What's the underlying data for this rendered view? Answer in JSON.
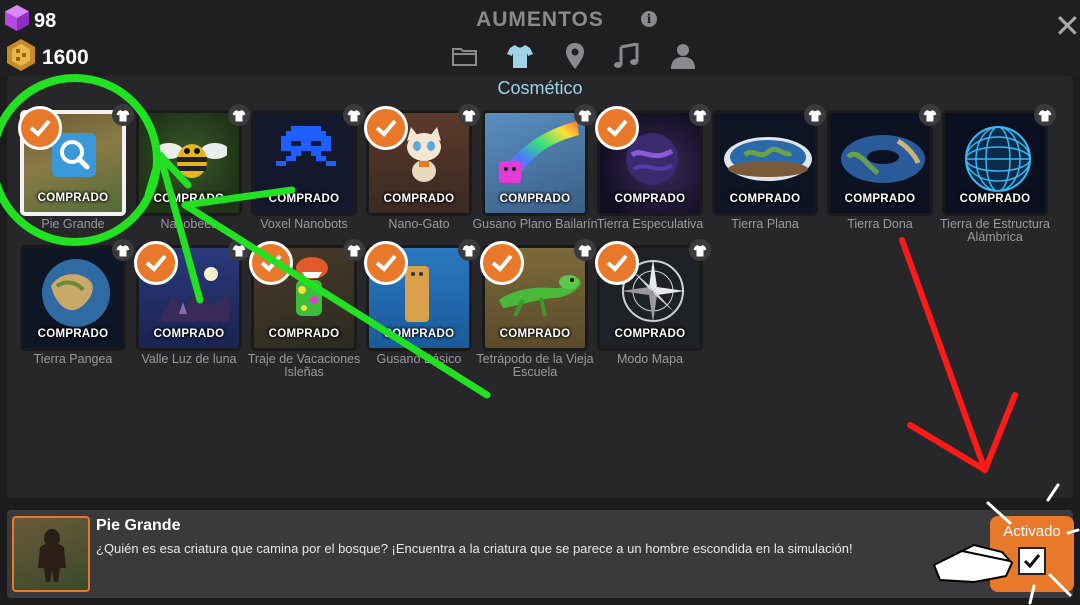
{
  "header": {
    "gems": "98",
    "coins": "1600",
    "title": "AUMENTOS"
  },
  "section": {
    "title": "Cosmético"
  },
  "tiles": [
    {
      "name": "Pie Grande",
      "badge": "COMPRADO"
    },
    {
      "name": "Nanobees",
      "badge": "COMPRADO"
    },
    {
      "name": "Voxel Nanobots",
      "badge": "COMPRADO"
    },
    {
      "name": "Nano-Gato",
      "badge": "COMPRADO"
    },
    {
      "name": "Gusano Plano Bailarín",
      "badge": "COMPRADO"
    },
    {
      "name": "Tierra Especulativa",
      "badge": "COMPRADO"
    },
    {
      "name": "Tierra Plana",
      "badge": "COMPRADO"
    },
    {
      "name": "Tierra Dona",
      "badge": "COMPRADO"
    },
    {
      "name": "Tierra de Estructura Alámbrica",
      "badge": "COMPRADO"
    },
    {
      "name": "Tierra Pangea",
      "badge": "COMPRADO"
    },
    {
      "name": "Valle Luz de luna",
      "badge": "COMPRADO"
    },
    {
      "name": "Traje de Vacaciones Isleñas",
      "badge": "COMPRADO"
    },
    {
      "name": "Gusano Básico",
      "badge": "COMPRADO"
    },
    {
      "name": "Tetrápodo de la Vieja Escuela",
      "badge": "COMPRADO"
    },
    {
      "name": "Modo Mapa",
      "badge": "COMPRADO"
    }
  ],
  "detail": {
    "name": "Pie Grande",
    "description": "¿Quién es esa criatura que camina por el bosque? ¡Encuentra a la criatura que se parece a un hombre escondida en la simulación!",
    "button_label": "Activado"
  },
  "icons": {
    "gem": "gem-icon",
    "coin": "dna-coin-icon",
    "info": "info-icon",
    "close": "close-icon",
    "tabs": [
      "folder-icon",
      "shirt-icon",
      "map-pin-icon",
      "music-note-icon",
      "user-icon"
    ]
  },
  "colors": {
    "accent_orange": "#e8792b",
    "active_tab": "#9ed3e8",
    "section_title": "#9ed3e8",
    "annotation_green": "#22e022",
    "annotation_red": "#ff1a1a"
  }
}
